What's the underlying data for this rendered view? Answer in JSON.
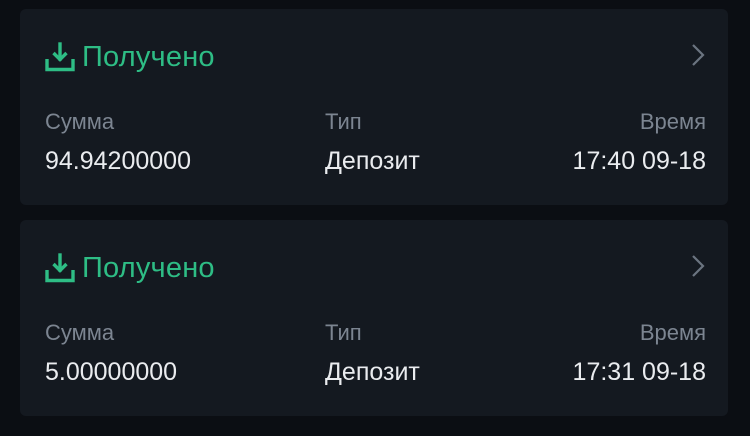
{
  "transactions": [
    {
      "status": "Получено",
      "amount_label": "Сумма",
      "amount": "94.94200000",
      "type_label": "Тип",
      "type": "Депозит",
      "time_label": "Время",
      "time": "17:40 09-18"
    },
    {
      "status": "Получено",
      "amount_label": "Сумма",
      "amount": "5.00000000",
      "type_label": "Тип",
      "type": "Депозит",
      "time_label": "Время",
      "time": "17:31 09-18"
    }
  ],
  "colors": {
    "status_green": "#2ebd85",
    "background": "#0b0e13",
    "card": "#141920"
  },
  "icons": {
    "status": "download-tray-icon",
    "row": "chevron-right-icon"
  }
}
